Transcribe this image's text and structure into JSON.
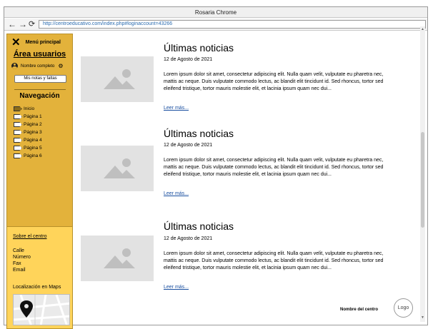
{
  "window": {
    "title": "Rosaria Chrome"
  },
  "browser": {
    "back_icon": "arrow-left",
    "forward_icon": "arrow-right",
    "reload_icon": "reload",
    "url": "http://centroeducativo.com/index.php#loginaccount=43266"
  },
  "sidebar": {
    "menu_label": "Menú principal",
    "area_title": "Área usuarios",
    "user_name": "Nombre completo",
    "grades_button": "Mis notas y faltas",
    "nav_title": "Navegación",
    "nav_items": [
      {
        "label": "Inicio",
        "active": true
      },
      {
        "label": "Página 1",
        "active": false
      },
      {
        "label": "Página 2",
        "active": false
      },
      {
        "label": "Página 3",
        "active": false
      },
      {
        "label": "Página 4",
        "active": false
      },
      {
        "label": "Página 5",
        "active": false
      },
      {
        "label": "Página 6",
        "active": false
      }
    ],
    "color": "#e3b23b"
  },
  "side_footer": {
    "about_link": "Sobre el centro",
    "street": "Calle",
    "number": "Número",
    "fax": "Fax",
    "email": "Email",
    "maps_label": "Localización en Maps",
    "color": "#ffd45a"
  },
  "articles": [
    {
      "title": "Últimas noticias",
      "date": "12 de Agosto de 2021",
      "body": "Lorem ipsum dolor sit amet, consectetur adipiscing elit. Nulla quam velit, vulputate eu pharetra nec, mattis ac neque. Duis vulputate commodo lectus, ac blandit elit tincidunt id. Sed rhoncus, tortor sed eleifend tristique, tortor mauris molestie elit, et lacinia ipsum quam nec dui...",
      "more": "Leer más..."
    },
    {
      "title": "Últimas noticias",
      "date": "12 de Agosto de 2021",
      "body": "Lorem ipsum dolor sit amet, consectetur adipiscing elit. Nulla quam velit, vulputate eu pharetra nec, mattis ac neque. Duis vulputate commodo lectus, ac blandit elit tincidunt id. Sed rhoncus, tortor sed eleifend tristique, tortor mauris molestie elit, et lacinia ipsum quam nec dui...",
      "more": "Leer más..."
    },
    {
      "title": "Últimas noticias",
      "date": "12 de Agosto de 2021",
      "body": "Lorem ipsum dolor sit amet, consectetur adipiscing elit. Nulla quam velit, vulputate eu pharetra nec, mattis ac neque. Duis vulputate commodo lectus, ac blandit elit tincidunt id. Sed rhoncus, tortor sed eleifend tristique, tortor mauris molestie elit, et lacinia ipsum quam nec dui...",
      "more": "Leer más..."
    }
  ],
  "page_footer": {
    "center_name": "Nombre del centro",
    "logo": "Logo"
  },
  "link_color": "#1a4fa0"
}
